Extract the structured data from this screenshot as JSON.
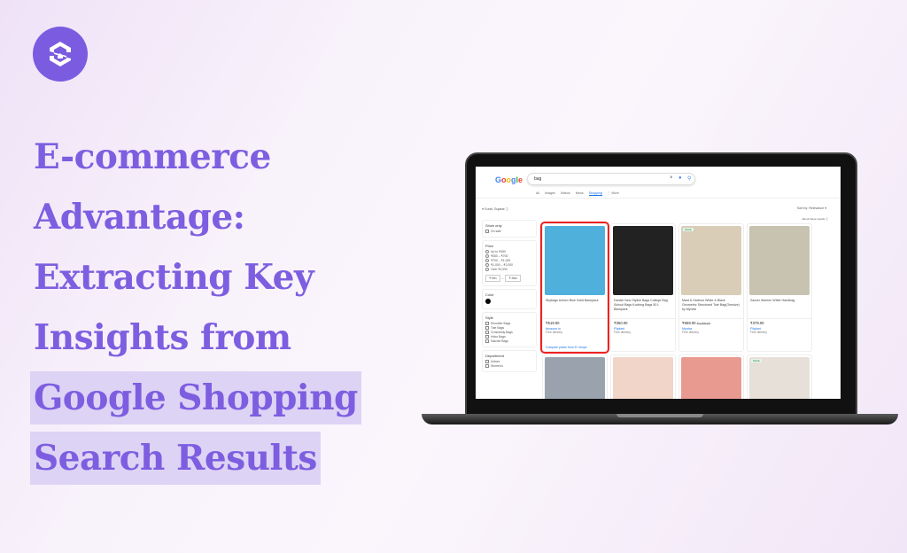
{
  "brand": {
    "logo_icon": "house-hexagon-logo",
    "accent": "#7b5be0"
  },
  "headline": {
    "lines": [
      "E-commerce",
      "Advantage:",
      "Extracting Key",
      "Insights from"
    ],
    "highlighted": [
      "Google Shopping",
      "Search Results"
    ]
  },
  "screen": {
    "search": {
      "logo": "Google",
      "query": "bag"
    },
    "tabs": [
      "All",
      "Images",
      "Videos",
      "News",
      "Shopping",
      "⋮ More"
    ],
    "active_tab": "Shopping",
    "location": "Surat, Gujarat",
    "sort": "Sort by: Relevance ▾",
    "about": "About these results ⓘ",
    "filters": {
      "show_only": {
        "title": "Show only",
        "items": [
          "On sale"
        ]
      },
      "price": {
        "title": "Price",
        "items": [
          "Up to ₹450",
          "₹450 – ₹700",
          "₹700 – ₹1,000",
          "₹1,000 – ₹2,000",
          "Over ₹2,000"
        ],
        "min": "₹ Min",
        "max": "₹ Max"
      },
      "color": {
        "title": "Color"
      },
      "style": {
        "title": "Style",
        "items": [
          "Shoulder Bags",
          "Tote Bags",
          "Crossbody Bags",
          "Hobo Bags",
          "Satchel Bags"
        ]
      },
      "department": {
        "title": "Department",
        "items": [
          "Unisex",
          "Women's"
        ]
      }
    },
    "products": [
      {
        "name": "Skybags Unisex Blue Solid Backpack",
        "price": "₹519.00",
        "store": "Amazon.in",
        "delivery": "Free delivery",
        "compare": "Compare prices from 5+ shops",
        "color": "#4fb0dc"
      },
      {
        "name": "Danish New Stylish Bags College Bag School Bags Koching Bags 50 L Backpack",
        "price": "₹350.00",
        "store": "Flipkart",
        "delivery": "Free delivery",
        "color": "#222"
      },
      {
        "name": "Mast & Harbour White & Black Geometric Structured Tote Bag(Onesize) by Myntra",
        "price": "₹659.00",
        "old_price": "₹2,499.00",
        "store": "Myntra",
        "delivery": "Free delivery",
        "badge": "SALE",
        "color": "#d9cdb8"
      },
      {
        "name": "Zaxcer Women White Handbag",
        "price": "₹379.00",
        "store": "Flipkart",
        "delivery": "Free delivery",
        "color": "#c8c3b0"
      }
    ],
    "row2": [
      {
        "color": "#9aa3ad"
      },
      {
        "color": "#f0d5c8"
      },
      {
        "color": "#e89a90"
      },
      {
        "color": "#e6e0d8",
        "badge": "SALE"
      }
    ]
  }
}
